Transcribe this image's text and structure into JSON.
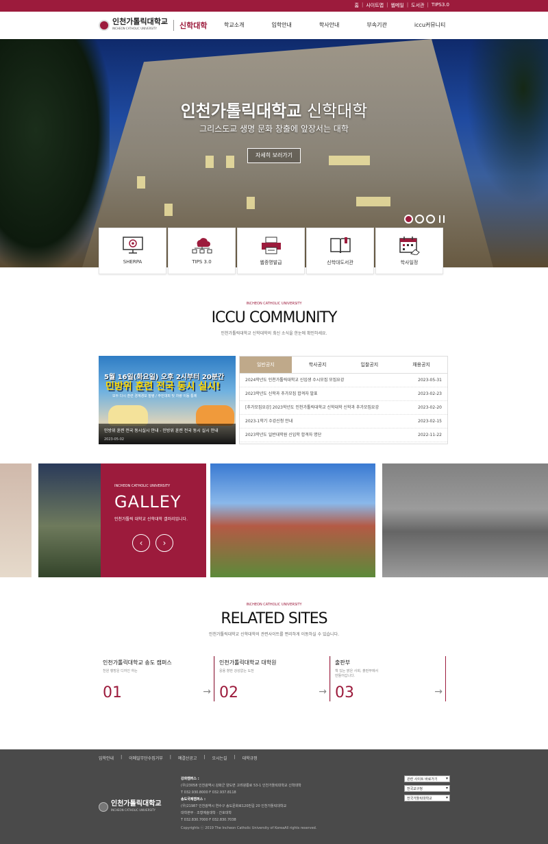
{
  "util_links": [
    "홈",
    "사이트맵",
    "웹메일",
    "도서관",
    "TIPS3.0"
  ],
  "logo": {
    "name": "인천가톨릭대학교",
    "name_en": "INCHEON CATHOLIC UNIVERSITY",
    "college": "신학대학"
  },
  "menu": [
    "학교소개",
    "입학안내",
    "학사안내",
    "부속기관",
    "iccu커뮤니티"
  ],
  "hero": {
    "title_bold": "인천가톨릭대학교",
    "title_rest": " 신학대학",
    "subtitle": "그리스도교 생명 문화 창출에 앞장서는 대학",
    "more_button": "자세히 보러가기",
    "slides_total": 3,
    "slide_active": 1
  },
  "quick_links": [
    {
      "label": "SHERPA",
      "icon": "monitor-target-icon"
    },
    {
      "label": "TIPS 3.0",
      "icon": "cloud-network-icon"
    },
    {
      "label": "웹증명발급",
      "icon": "printer-icon"
    },
    {
      "label": "신학대도서관",
      "icon": "book-icon"
    },
    {
      "label": "학사일정",
      "icon": "calendar-icon"
    }
  ],
  "community": {
    "kicker": "INCHEON CATHOLIC UNIVERSITY",
    "title": "ICCU COMMUNITY",
    "desc": "인천가톨릭대학교 신학대학의 최신 소식을 한눈에 확인하세요.",
    "image": {
      "headline": "5월 16일(화요일) 오후 2시부터 20분간",
      "big": "민방위 훈련 전국 동시 실시!",
      "small": "모두 다시 훈련 경계경보 발령 / 주민대피 및 차량 이동 통제",
      "caption": "민방위 훈련 전국 동시실시 안내 - 민방위 훈련 전국 동시 실시 안내",
      "date": "2023-05-02"
    },
    "tabs": [
      "일반공지",
      "학사공지",
      "입찰공지",
      "채용공지"
    ],
    "active_tab": 0,
    "notices": [
      {
        "title": "2024학년도 인천가톨릭대학교 신입생 수시모집 모집요강",
        "date": "2023-05-31"
      },
      {
        "title": "2023학년도 신학과 추가모집 합격자 발표",
        "date": "2023-02-23"
      },
      {
        "title": "[추가모집요강] 2023학년도 인천가톨릭대학교 신학대학 신학과 추가모집요강",
        "date": "2023-02-20"
      },
      {
        "title": "2023-1학기 수강신청 안내",
        "date": "2023-02-15"
      },
      {
        "title": "2023학년도 일반대학원 신입학 합격자 명단",
        "date": "2022-11-22"
      }
    ]
  },
  "gallery": {
    "kicker": "INCHEON CATHOLIC UNIVERSITY",
    "title": "GALLEY",
    "desc": "인천가톨릭 대학교 신학대학 갤러리입니다.",
    "prev": "‹",
    "next": "›"
  },
  "related": {
    "kicker": "INCHEON CATHOLIC UNIVERSITY",
    "title": "RELATED SITES",
    "desc": "인천가톨릭대학교 신학대학의 관련사이트를 편리하게 이동하실 수 있습니다.",
    "sites": [
      {
        "title": "인천가톨릭대학교 송도 캠퍼스",
        "desc": "천원 행방운 디자인 하는",
        "num": "01"
      },
      {
        "title": "인천가톨릭대학교 대학원",
        "desc": "응용 향한 강성없는 도전",
        "num": "02"
      },
      {
        "title": "출판부",
        "desc": "책 있는 밝은 사회, 출판부에서\n만들어갑니다.",
        "num": "03"
      }
    ]
  },
  "footer": {
    "links": [
      "입학안내",
      "이메일무단수집거부",
      "예결산공고",
      "오시는길",
      "대학규정"
    ],
    "logo_name": "인천가톨릭대학교",
    "logo_en": "INCHEON CATHOLIC UNIVERSITY",
    "campus1_label": "강화캠퍼스 :",
    "campus1_addr": "(우)23058 인천광역시 강화군 양도면 고려왕릉로 53-1 인천가톨릭대학교 신학대학",
    "campus1_tel": "T 032.930.8000    F 032.937.8118",
    "campus2_label": "송도국제캠퍼스 :",
    "campus2_addr": "(우)21987 인천광역시 연수구 송도문화로120번길 20 인천가톨릭대학교",
    "campus2_dept": "대학본부 · 조형예술대학 · 간호대학",
    "campus2_tel": "T 032.830.7000    F 032.830.7038",
    "copyright": "Copyrights ⓒ 2019 The Incheon Catholic University of KoreaAll rights reserved.",
    "selects": [
      "관련 사이트 바로가기",
      "전국교구청",
      "전국가톨릭대학교"
    ]
  },
  "colors": {
    "brand": "#9c1b3c",
    "tab_active": "#bfa98a",
    "footer_bg": "#4a4a4a"
  }
}
